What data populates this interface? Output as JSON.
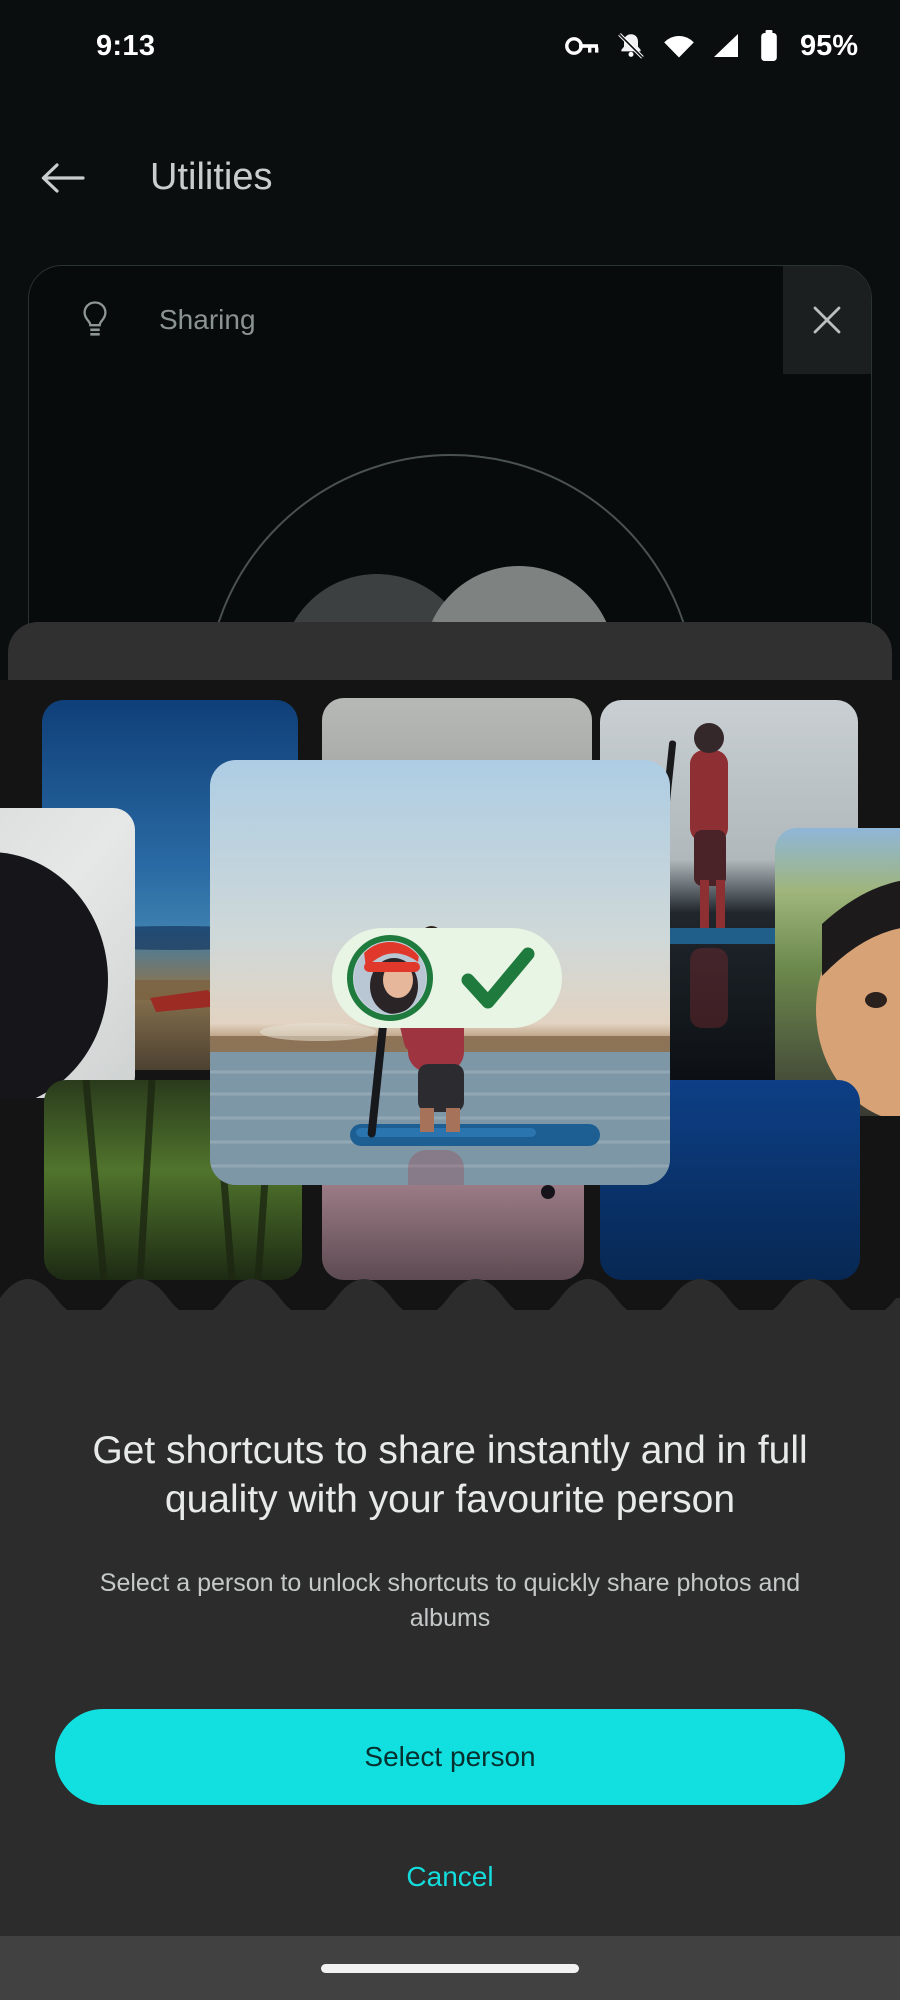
{
  "status_bar": {
    "time": "9:13",
    "battery_percent": "95%",
    "icons": [
      "vpn-key-icon",
      "notifications-muted-icon",
      "wifi-icon",
      "cellular-signal-icon",
      "battery-icon"
    ]
  },
  "app_bar": {
    "back_icon": "arrow-back-icon",
    "title": "Utilities"
  },
  "tip_card": {
    "icon": "lightbulb-icon",
    "label": "Sharing",
    "close_icon": "close-icon"
  },
  "collage": {
    "hero_badge": {
      "avatar_icon": "person-avatar",
      "check_icon": "check-icon",
      "ring_color": "#1f7a3d",
      "pill_color": "#e8f5e4",
      "check_color": "#1f7a3d"
    },
    "photos": [
      {
        "name": "photo-beach-water",
        "alt": "blue sea and beach"
      },
      {
        "name": "photo-person-dark",
        "alt": "person on grey background"
      },
      {
        "name": "photo-paddleboarder-2",
        "alt": "paddleboarder on lake"
      },
      {
        "name": "photo-black-dog",
        "alt": "black labrador puppy"
      },
      {
        "name": "photo-woman-dog",
        "alt": "woman selfie with dog in dunes"
      },
      {
        "name": "photo-forest",
        "alt": "green forest canopy"
      },
      {
        "name": "photo-sunset",
        "alt": "pink sunset sky"
      },
      {
        "name": "photo-night-blue",
        "alt": "deep blue night scene"
      },
      {
        "name": "photo-hero-paddleboard",
        "alt": "man paddleboarding at sunset"
      }
    ]
  },
  "sheet": {
    "title": "Get shortcuts to share instantly and in full quality with your favourite person",
    "subtitle": "Select a person to unlock shortcuts to quickly share photos and albums",
    "primary_label": "Select person",
    "cancel_label": "Cancel"
  },
  "colors": {
    "accent": "#12e0e0",
    "accent_text": "#14dcdc",
    "sheet_bg": "#2c2c2c",
    "screen_bg": "#0a0e0e",
    "title_text": "#c9cecd"
  },
  "nav_bar": {
    "handle": "gesture-handle"
  }
}
